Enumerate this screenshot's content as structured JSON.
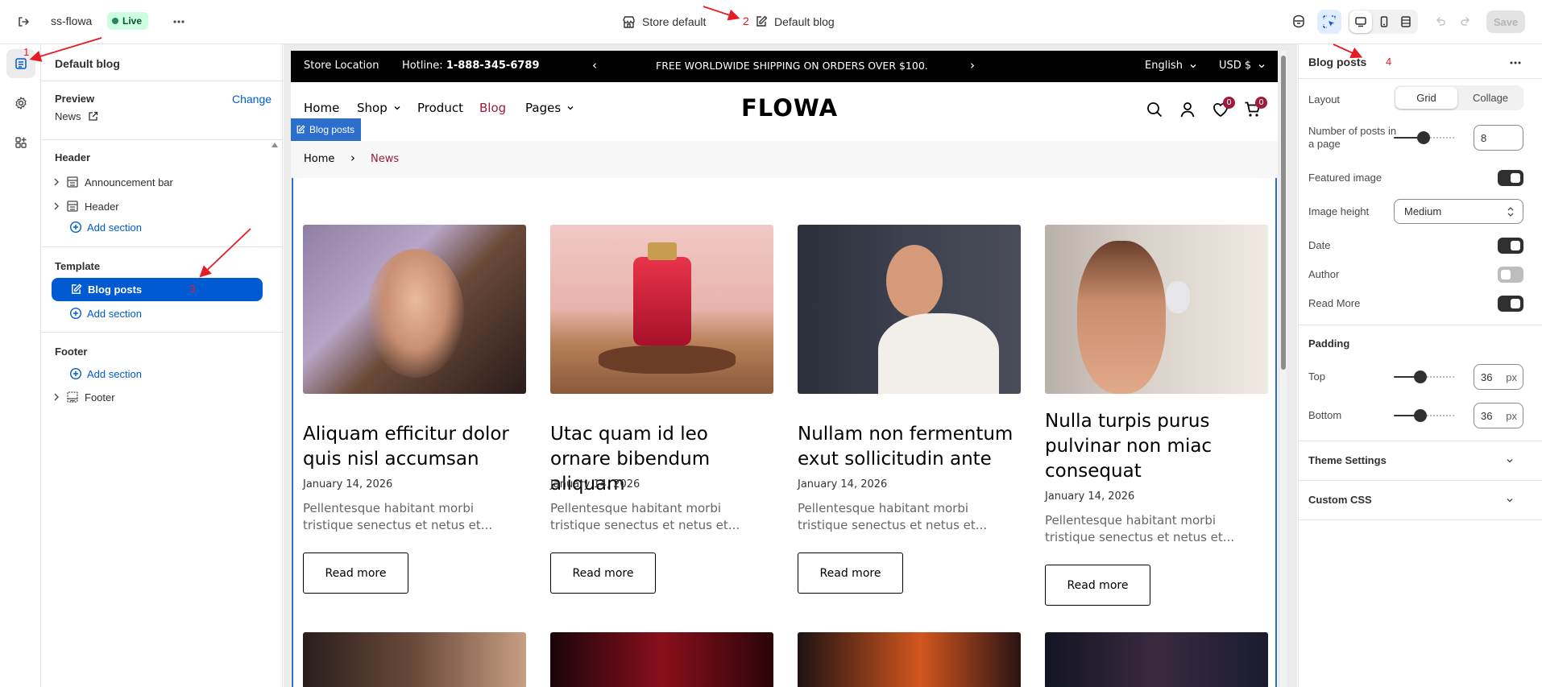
{
  "topbar": {
    "store_name": "ss-flowa",
    "live_badge": "Live",
    "store_label": "Store default",
    "template_label": "Default blog",
    "save_label": "Save"
  },
  "left_panel": {
    "title": "Default blog",
    "preview_label": "Preview",
    "change_label": "Change",
    "preview_value": "News",
    "header_group": "Header",
    "header_items": [
      "Announcement bar",
      "Header"
    ],
    "add_section": "Add section",
    "template_group": "Template",
    "template_item": "Blog posts",
    "footer_group": "Footer",
    "footer_item": "Footer"
  },
  "storefront": {
    "announcement": {
      "store_location": "Store Location",
      "hotline_label": "Hotline:",
      "hotline_number": "1-888-345-6789",
      "message": "FREE WORLDWIDE SHIPPING ON ORDERS OVER $100.",
      "language": "English",
      "currency": "USD $"
    },
    "nav": {
      "items": [
        "Home",
        "Shop",
        "Product",
        "Blog",
        "Pages"
      ],
      "logo": "FLOWA",
      "wishlist_count": "0",
      "cart_count": "0"
    },
    "section_tag": "Blog posts",
    "breadcrumb": [
      "Home",
      "News"
    ],
    "posts": [
      {
        "title": "Aliquam efficitur dolor quis nisl accumsan",
        "date": "January 14, 2026",
        "excerpt": "Pellentesque habitant morbi tristique senectus et netus et...",
        "button": "Read more"
      },
      {
        "title": "Utac quam id leo ornare bibendum aliquam",
        "date": "January 14, 2026",
        "excerpt": "Pellentesque habitant morbi tristique senectus et netus et...",
        "button": "Read more"
      },
      {
        "title": "Nullam non fermentum exut sollicitudin ante",
        "date": "January 14, 2026",
        "excerpt": "Pellentesque habitant morbi tristique senectus et netus et...",
        "button": "Read more"
      },
      {
        "title": "Nulla turpis purus pulvinar non miac consequat",
        "date": "January 14, 2026",
        "excerpt": "Pellentesque habitant morbi tristique senectus et netus et...",
        "button": "Read more"
      }
    ]
  },
  "right_panel": {
    "title": "Blog posts",
    "layout_label": "Layout",
    "layout_options": [
      "Grid",
      "Collage"
    ],
    "layout_selected": "Grid",
    "posts_per_page_label": "Number of posts in a page",
    "posts_per_page": "8",
    "posts_per_page_fraction": 0.4,
    "featured_image_label": "Featured image",
    "featured_image_on": true,
    "image_height_label": "Image height",
    "image_height_value": "Medium",
    "date_label": "Date",
    "date_on": true,
    "author_label": "Author",
    "author_on": false,
    "read_more_label": "Read More",
    "read_more_on": true,
    "padding_heading": "Padding",
    "top_label": "Top",
    "top_value": "36",
    "bottom_label": "Bottom",
    "bottom_value": "36",
    "unit": "px",
    "theme_settings": "Theme Settings",
    "custom_css": "Custom CSS"
  },
  "annotations": [
    "1",
    "2",
    "3",
    "4"
  ],
  "colors": {
    "accent": "#005bd3",
    "live_bg": "#cdfee1",
    "live_dot": "#29845a",
    "blog_link": "#9b1c3b",
    "toggle_on": "#303030",
    "toggle_off": "#bdbdbd",
    "annotation": "#e51c23"
  }
}
